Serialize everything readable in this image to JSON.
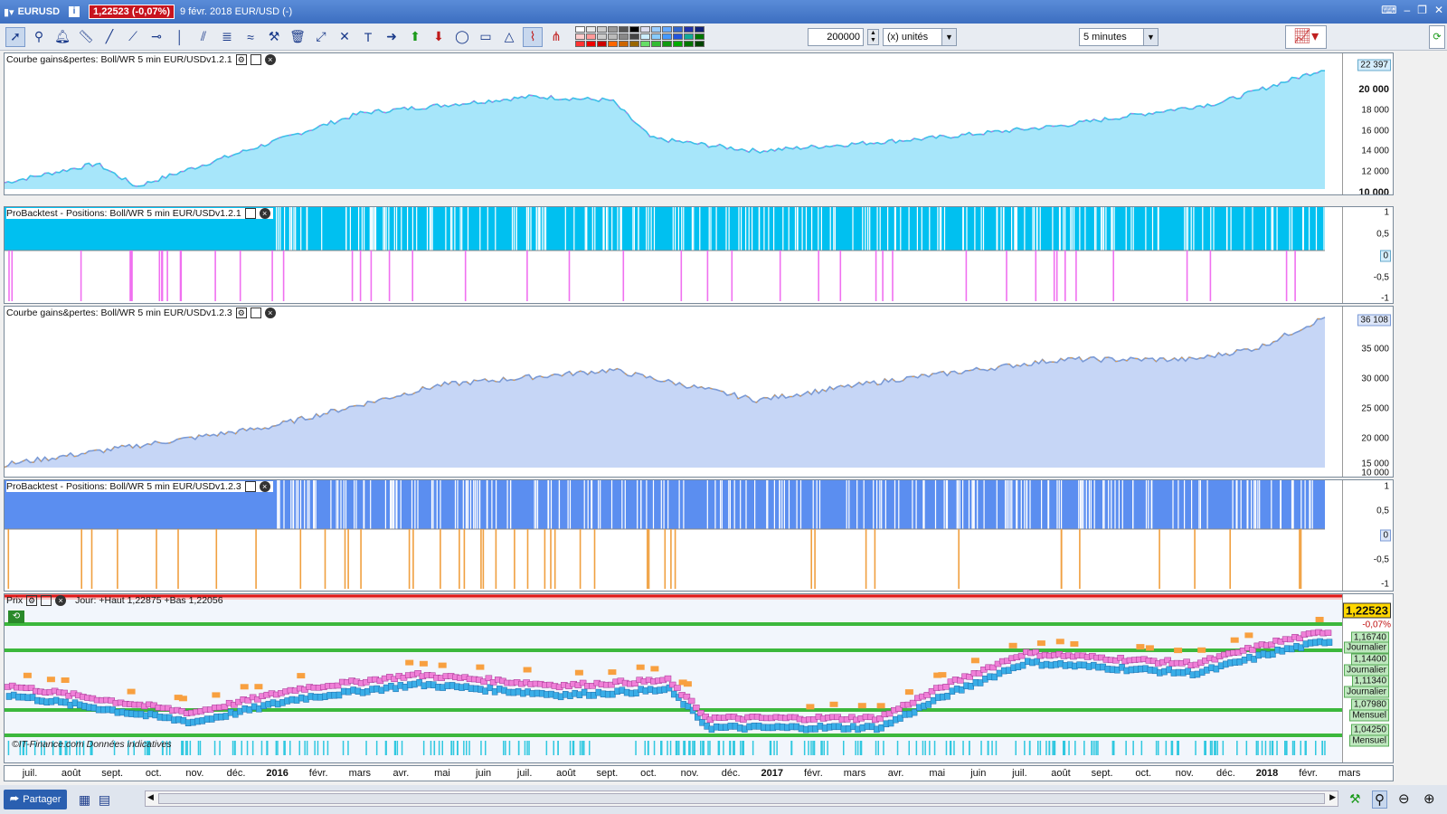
{
  "window": {
    "symbol": "EURUSD",
    "price_badge": "1,22523 (-0,07%)",
    "date_text": "9 févr. 2018 EUR/USD (-)"
  },
  "toolbar": {
    "quantity": "200000",
    "unit": "(x) unités",
    "timeframe": "5 minutes"
  },
  "panels": {
    "equity1": {
      "title": "Courbe gains&pertes: Boll/WR 5 min EUR/USDv1.2.1",
      "last": "22 397",
      "ticks": [
        "20 000",
        "18 000",
        "16 000",
        "14 000",
        "12 000",
        "10 000"
      ]
    },
    "pos1": {
      "title": "ProBacktest - Positions: Boll/WR 5 min EUR/USDv1.2.1",
      "ticks": [
        "1",
        "0,5",
        "0",
        "-0,5",
        "-1"
      ]
    },
    "equity2": {
      "title": "Courbe gains&pertes: Boll/WR 5 min EUR/USDv1.2.3",
      "last": "36 108",
      "ticks": [
        "35 000",
        "30 000",
        "25 000",
        "20 000",
        "15 000",
        "10 000"
      ]
    },
    "pos2": {
      "title": "ProBacktest - Positions: Boll/WR 5 min EUR/USDv1.2.3",
      "ticks": [
        "1",
        "0,5",
        "0",
        "-0,5",
        "-1"
      ]
    },
    "price": {
      "title": "Prix",
      "legend": "Jour: +Haut 1,22875 +Bas 1,22056",
      "last": "1,22523",
      "change": "-0,07%",
      "levels": [
        {
          "value": "1,16740",
          "tag": "Journalier"
        },
        {
          "value": "1,14400",
          "tag": "Journalier"
        },
        {
          "value": "1,11340",
          "tag": "Journalier"
        },
        {
          "value": "1,07980",
          "tag": "Mensuel"
        },
        {
          "value": "1,04250",
          "tag": "Mensuel"
        }
      ],
      "credit": "©IT-Finance.com Données indicatives"
    }
  },
  "timeaxis": [
    {
      "label": "juil.",
      "bold": false
    },
    {
      "label": "août",
      "bold": false
    },
    {
      "label": "sept.",
      "bold": false
    },
    {
      "label": "oct.",
      "bold": false
    },
    {
      "label": "nov.",
      "bold": false
    },
    {
      "label": "déc.",
      "bold": false
    },
    {
      "label": "2016",
      "bold": true
    },
    {
      "label": "févr.",
      "bold": false
    },
    {
      "label": "mars",
      "bold": false
    },
    {
      "label": "avr.",
      "bold": false
    },
    {
      "label": "mai",
      "bold": false
    },
    {
      "label": "juin",
      "bold": false
    },
    {
      "label": "juil.",
      "bold": false
    },
    {
      "label": "août",
      "bold": false
    },
    {
      "label": "sept.",
      "bold": false
    },
    {
      "label": "oct.",
      "bold": false
    },
    {
      "label": "nov.",
      "bold": false
    },
    {
      "label": "déc.",
      "bold": false
    },
    {
      "label": "2017",
      "bold": true
    },
    {
      "label": "févr.",
      "bold": false
    },
    {
      "label": "mars",
      "bold": false
    },
    {
      "label": "avr.",
      "bold": false
    },
    {
      "label": "mai",
      "bold": false
    },
    {
      "label": "juin",
      "bold": false
    },
    {
      "label": "juil.",
      "bold": false
    },
    {
      "label": "août",
      "bold": false
    },
    {
      "label": "sept.",
      "bold": false
    },
    {
      "label": "oct.",
      "bold": false
    },
    {
      "label": "nov.",
      "bold": false
    },
    {
      "label": "déc.",
      "bold": false
    },
    {
      "label": "2018",
      "bold": true
    },
    {
      "label": "févr.",
      "bold": false
    },
    {
      "label": "mars",
      "bold": false
    }
  ],
  "bottom": {
    "share_label": "Partager"
  },
  "colors": {
    "equity1": "#a7e6fa",
    "equity2": "#c6d6f6",
    "pos1": "#00c0f0",
    "pos2": "#5b8ef0",
    "neg1": "#f070f0",
    "neg2": "#f0a040",
    "support": "#3cb83c",
    "resistance": "#e01818"
  }
}
